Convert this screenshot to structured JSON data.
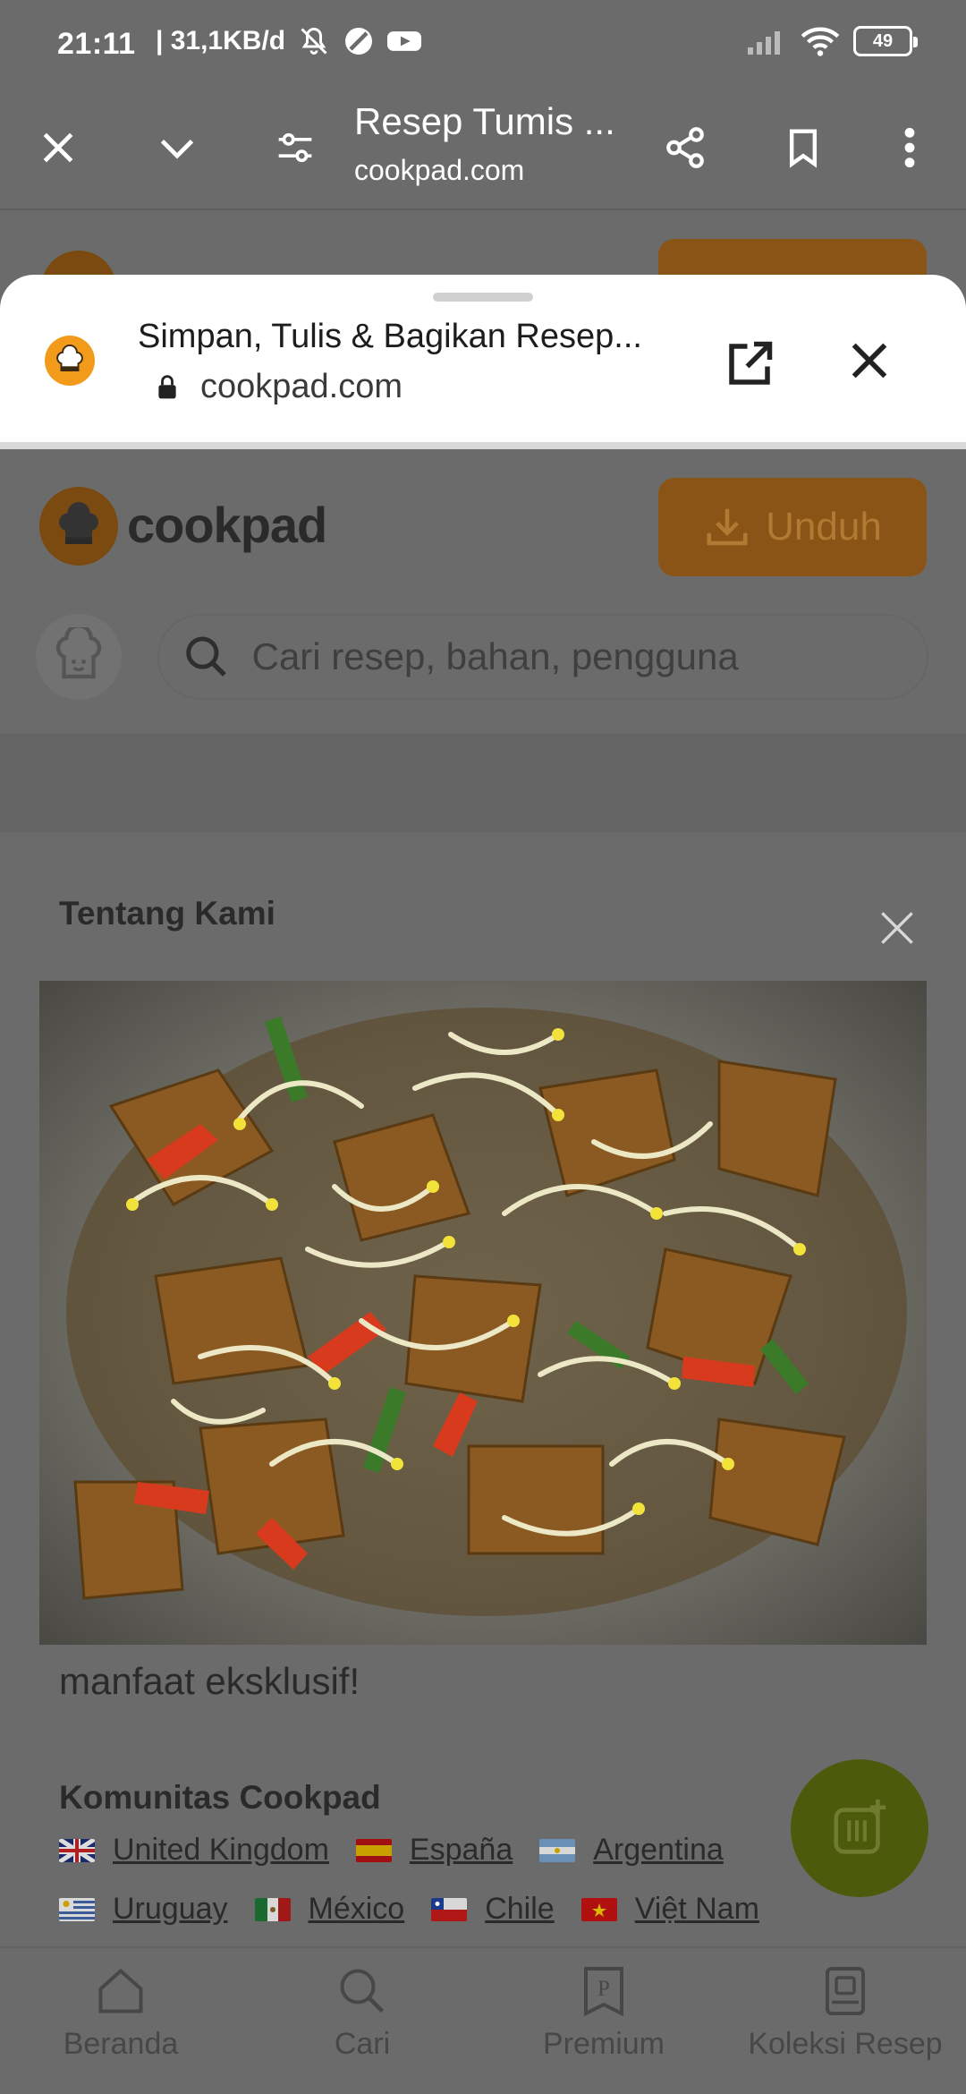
{
  "status_bar": {
    "time": "21:11",
    "network_speed": "| 31,1KB/d",
    "battery": "49"
  },
  "toolbar": {
    "title": "Resep Tumis ...",
    "url": "cookpad.com"
  },
  "sheet": {
    "title": "Simpan, Tulis & Bagikan Resep...",
    "url": "cookpad.com"
  },
  "page": {
    "brand": "cookpad",
    "download_label": "Unduh",
    "search_placeholder": "Cari resep, bahan, pengguna",
    "about_title": "Tentang Kami",
    "about_text": "manfaat eksklusif!",
    "community_title": "Komunitas Cookpad",
    "countries_row1": [
      "United Kingdom",
      "España",
      "Argentina"
    ],
    "countries_row2": [
      "Uruguay",
      "México",
      "Chile",
      "Việt Nam"
    ]
  },
  "bottom_nav": {
    "items": [
      "Beranda",
      "Cari",
      "Premium",
      "Koleksi Resep"
    ]
  },
  "colors": {
    "overlay_gray": "#6b6b6b",
    "brand_orange": "#f29a1a",
    "fab_green": "#4c5a0c"
  }
}
